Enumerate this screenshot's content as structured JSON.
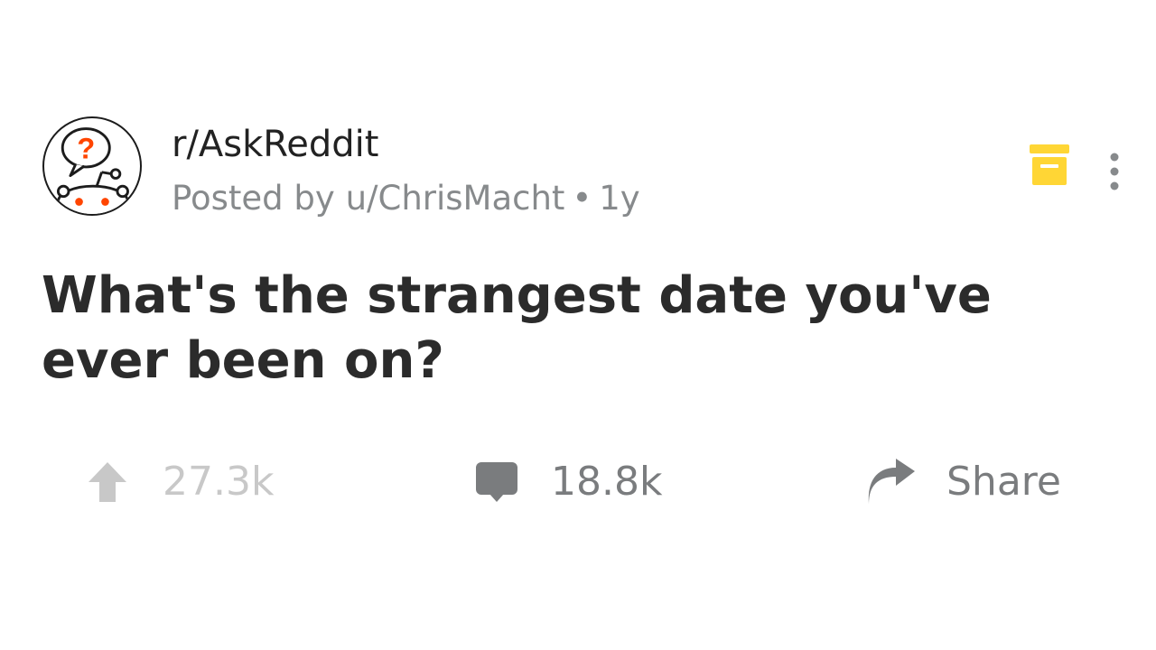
{
  "post": {
    "subreddit": "r/AskReddit",
    "posted_by": "Posted by u/ChrisMacht",
    "separator": "•",
    "age": "1y",
    "title": "What's the strangest date you've ever been on?",
    "icons": {
      "avatar": "askreddit-avatar-icon",
      "archive": "archive-icon",
      "more": "more-vertical-icon",
      "upvote": "upvote-arrow-icon",
      "comment": "comment-bubble-icon",
      "share": "share-arrow-icon"
    },
    "colors": {
      "archive": "#ffd635",
      "avatar_question": "#ff4500",
      "text_primary": "#2b2b2b",
      "text_meta": "#878a8c",
      "vote_inactive": "#c8c8c8",
      "action_gray": "#7a7c7e"
    }
  },
  "actions": {
    "upvotes": "27.3k",
    "comments": "18.8k",
    "share_label": "Share"
  }
}
